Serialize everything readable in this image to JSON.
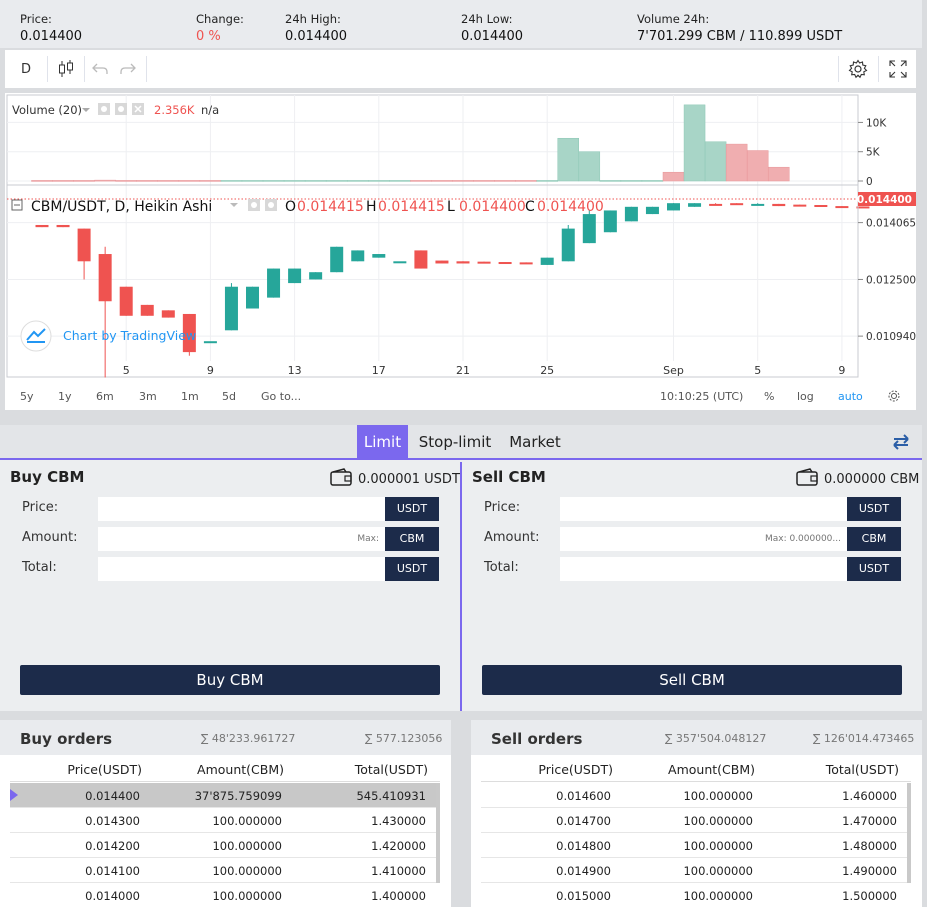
{
  "stats": {
    "price_label": "Price:",
    "price_value": "0.014400",
    "change_label": "Change:",
    "change_value": "0 %",
    "high_label": "24h High:",
    "high_value": "0.014400",
    "low_label": "24h Low:",
    "low_value": "0.014400",
    "volume_label": "Volume 24h:",
    "volume_value": "7'701.299 CBM / 110.899 USDT"
  },
  "toolbar": {
    "interval": "D"
  },
  "chart": {
    "volume_legend": "Volume (20)",
    "volume_value": "2.356K",
    "volume_na": "n/a",
    "symbol_legend": "CBM/USDT, D, Heikin Ashi",
    "o_label": "O",
    "o_value": "0.014415",
    "h_label": "H",
    "h_value": "0.014415",
    "l_label": "L",
    "l_value": "0.014400",
    "c_label": "C",
    "c_value": "0.014400",
    "last_price": "0.014400",
    "watermark": "Chart by TradingView",
    "volume_ticks": [
      "10K",
      "5K",
      "0"
    ],
    "price_ticks": [
      "0.014065",
      "0.012500",
      "0.010940"
    ],
    "x_ticks": [
      "5",
      "9",
      "13",
      "17",
      "21",
      "25",
      "Sep",
      "5",
      "9"
    ],
    "ranges": [
      "5y",
      "1y",
      "6m",
      "3m",
      "1m",
      "5d"
    ],
    "goto": "Go to...",
    "time": "10:10:25 (UTC)",
    "percent": "%",
    "log": "log",
    "auto": "auto",
    "colors": {
      "up": "#26a69a",
      "down": "#ef5350",
      "accent": "#2196f3"
    }
  },
  "chart_data": {
    "type": "candlestick",
    "title": "CBM/USDT, D, Heikin Ashi",
    "ylim": [
      0.01,
      0.0147
    ],
    "y_ticks": [
      0.014065,
      0.0125,
      0.01094
    ],
    "candles": [
      {
        "o": 0.014,
        "h": 0.014,
        "l": 0.01394,
        "c": 0.01394
      },
      {
        "o": 0.014,
        "h": 0.014,
        "l": 0.01394,
        "c": 0.01394
      },
      {
        "o": 0.0139,
        "h": 0.0139,
        "l": 0.0125,
        "c": 0.013
      },
      {
        "o": 0.0132,
        "h": 0.0134,
        "l": 0.0098,
        "c": 0.0119
      },
      {
        "o": 0.0123,
        "h": 0.0123,
        "l": 0.0115,
        "c": 0.0115
      },
      {
        "o": 0.0118,
        "h": 0.0118,
        "l": 0.0115,
        "c": 0.0115
      },
      {
        "o": 0.01165,
        "h": 0.01165,
        "l": 0.01145,
        "c": 0.01145
      },
      {
        "o": 0.01155,
        "h": 0.01155,
        "l": 0.0104,
        "c": 0.0105
      },
      {
        "o": 0.0108,
        "h": 0.0108,
        "l": 0.0108,
        "c": 0.0108
      },
      {
        "o": 0.0111,
        "h": 0.0124,
        "l": 0.0111,
        "c": 0.0123
      },
      {
        "o": 0.0117,
        "h": 0.0123,
        "l": 0.0117,
        "c": 0.0123
      },
      {
        "o": 0.012,
        "h": 0.0128,
        "l": 0.012,
        "c": 0.0128
      },
      {
        "o": 0.0124,
        "h": 0.0128,
        "l": 0.0124,
        "c": 0.0128
      },
      {
        "o": 0.0125,
        "h": 0.0127,
        "l": 0.0125,
        "c": 0.0127
      },
      {
        "o": 0.0127,
        "h": 0.0134,
        "l": 0.0127,
        "c": 0.0134
      },
      {
        "o": 0.013,
        "h": 0.0133,
        "l": 0.013,
        "c": 0.0133
      },
      {
        "o": 0.0131,
        "h": 0.0132,
        "l": 0.0131,
        "c": 0.0132
      },
      {
        "o": 0.013,
        "h": 0.0131,
        "l": 0.0131,
        "c": 0.013
      },
      {
        "o": 0.0133,
        "h": 0.0133,
        "l": 0.0128,
        "c": 0.0128
      },
      {
        "o": 0.01302,
        "h": 0.01302,
        "l": 0.01294,
        "c": 0.01294
      },
      {
        "o": 0.013,
        "h": 0.013,
        "l": 0.01294,
        "c": 0.01294
      },
      {
        "o": 0.01299,
        "h": 0.01299,
        "l": 0.01294,
        "c": 0.01294
      },
      {
        "o": 0.01298,
        "h": 0.01298,
        "l": 0.01294,
        "c": 0.01294
      },
      {
        "o": 0.01297,
        "h": 0.01297,
        "l": 0.01294,
        "c": 0.01294
      },
      {
        "o": 0.0129,
        "h": 0.0131,
        "l": 0.0129,
        "c": 0.0131
      },
      {
        "o": 0.013,
        "h": 0.014,
        "l": 0.013,
        "c": 0.0139
      },
      {
        "o": 0.0135,
        "h": 0.0144,
        "l": 0.0135,
        "c": 0.0143
      },
      {
        "o": 0.0138,
        "h": 0.0144,
        "l": 0.0138,
        "c": 0.0144
      },
      {
        "o": 0.0141,
        "h": 0.0145,
        "l": 0.0141,
        "c": 0.0145
      },
      {
        "o": 0.0143,
        "h": 0.0145,
        "l": 0.0143,
        "c": 0.0145
      },
      {
        "o": 0.0144,
        "h": 0.0146,
        "l": 0.0144,
        "c": 0.0146
      },
      {
        "o": 0.0145,
        "h": 0.0146,
        "l": 0.0145,
        "c": 0.0146
      },
      {
        "o": 0.01458,
        "h": 0.0146,
        "l": 0.01455,
        "c": 0.01455
      },
      {
        "o": 0.0146,
        "h": 0.0146,
        "l": 0.01455,
        "c": 0.01457
      },
      {
        "o": 0.01455,
        "h": 0.0146,
        "l": 0.01455,
        "c": 0.01458
      },
      {
        "o": 0.01458,
        "h": 0.01458,
        "l": 0.01452,
        "c": 0.01452
      },
      {
        "o": 0.01456,
        "h": 0.01456,
        "l": 0.01452,
        "c": 0.01452
      },
      {
        "o": 0.01455,
        "h": 0.01455,
        "l": 0.0145,
        "c": 0.0145
      },
      {
        "o": 0.01452,
        "h": 0.01452,
        "l": 0.0145,
        "c": 0.0145
      },
      {
        "o": 0.01451,
        "h": 0.01451,
        "l": 0.01449,
        "c": 0.01449
      }
    ],
    "volume_ylim": [
      0,
      14000
    ],
    "volume": [
      {
        "v": 100,
        "up": false
      },
      {
        "v": 100,
        "up": false
      },
      {
        "v": 100,
        "up": false
      },
      {
        "v": 150,
        "up": false
      },
      {
        "v": 100,
        "up": false
      },
      {
        "v": 100,
        "up": false
      },
      {
        "v": 100,
        "up": false
      },
      {
        "v": 100,
        "up": false
      },
      {
        "v": 100,
        "up": false
      },
      {
        "v": 100,
        "up": true
      },
      {
        "v": 100,
        "up": true
      },
      {
        "v": 100,
        "up": true
      },
      {
        "v": 100,
        "up": true
      },
      {
        "v": 100,
        "up": true
      },
      {
        "v": 100,
        "up": true
      },
      {
        "v": 100,
        "up": true
      },
      {
        "v": 100,
        "up": true
      },
      {
        "v": 100,
        "up": true
      },
      {
        "v": 100,
        "up": false
      },
      {
        "v": 100,
        "up": false
      },
      {
        "v": 100,
        "up": false
      },
      {
        "v": 100,
        "up": false
      },
      {
        "v": 100,
        "up": false
      },
      {
        "v": 100,
        "up": false
      },
      {
        "v": 100,
        "up": true
      },
      {
        "v": 7300,
        "up": true
      },
      {
        "v": 5000,
        "up": true
      },
      {
        "v": 100,
        "up": true
      },
      {
        "v": 100,
        "up": true
      },
      {
        "v": 100,
        "up": true
      },
      {
        "v": 1500,
        "up": false
      },
      {
        "v": 13000,
        "up": true
      },
      {
        "v": 6700,
        "up": true
      },
      {
        "v": 6300,
        "up": false
      },
      {
        "v": 5200,
        "up": false
      },
      {
        "v": 2356,
        "up": false
      },
      {
        "v": 0,
        "up": false
      },
      {
        "v": 0,
        "up": false
      },
      {
        "v": 0,
        "up": false
      },
      {
        "v": 0,
        "up": false
      }
    ],
    "volume_y_ticks": [
      10000,
      5000,
      0
    ]
  },
  "order_form": {
    "tabs": [
      "Limit",
      "Stop-limit",
      "Market"
    ],
    "buy": {
      "title": "Buy CBM",
      "balance": "0.000001 USDT",
      "price_label": "Price:",
      "amount_label": "Amount:",
      "total_label": "Total:",
      "price_unit": "USDT",
      "amount_unit": "CBM",
      "total_unit": "USDT",
      "amount_placeholder": "Max:",
      "button": "Buy CBM"
    },
    "sell": {
      "title": "Sell CBM",
      "balance": "0.000000 CBM",
      "price_label": "Price:",
      "amount_label": "Amount:",
      "total_label": "Total:",
      "price_unit": "USDT",
      "amount_unit": "CBM",
      "total_unit": "USDT",
      "amount_placeholder": "Max: 0.000000...",
      "button": "Sell CBM"
    }
  },
  "buy_orders": {
    "title": "Buy orders",
    "sum_amount": "∑ 48'233.961727",
    "sum_total": "∑ 577.123056",
    "columns": [
      "Price(USDT)",
      "Amount(CBM)",
      "Total(USDT)"
    ],
    "rows": [
      [
        "0.014400",
        "37'875.759099",
        "545.410931"
      ],
      [
        "0.014300",
        "100.000000",
        "1.430000"
      ],
      [
        "0.014200",
        "100.000000",
        "1.420000"
      ],
      [
        "0.014100",
        "100.000000",
        "1.410000"
      ],
      [
        "0.014000",
        "100.000000",
        "1.400000"
      ]
    ]
  },
  "sell_orders": {
    "title": "Sell orders",
    "sum_amount": "∑ 357'504.048127",
    "sum_total": "∑ 126'014.473465",
    "columns": [
      "Price(USDT)",
      "Amount(CBM)",
      "Total(USDT)"
    ],
    "rows": [
      [
        "0.014600",
        "100.000000",
        "1.460000"
      ],
      [
        "0.014700",
        "100.000000",
        "1.470000"
      ],
      [
        "0.014800",
        "100.000000",
        "1.480000"
      ],
      [
        "0.014900",
        "100.000000",
        "1.490000"
      ],
      [
        "0.015000",
        "100.000000",
        "1.500000"
      ]
    ]
  }
}
